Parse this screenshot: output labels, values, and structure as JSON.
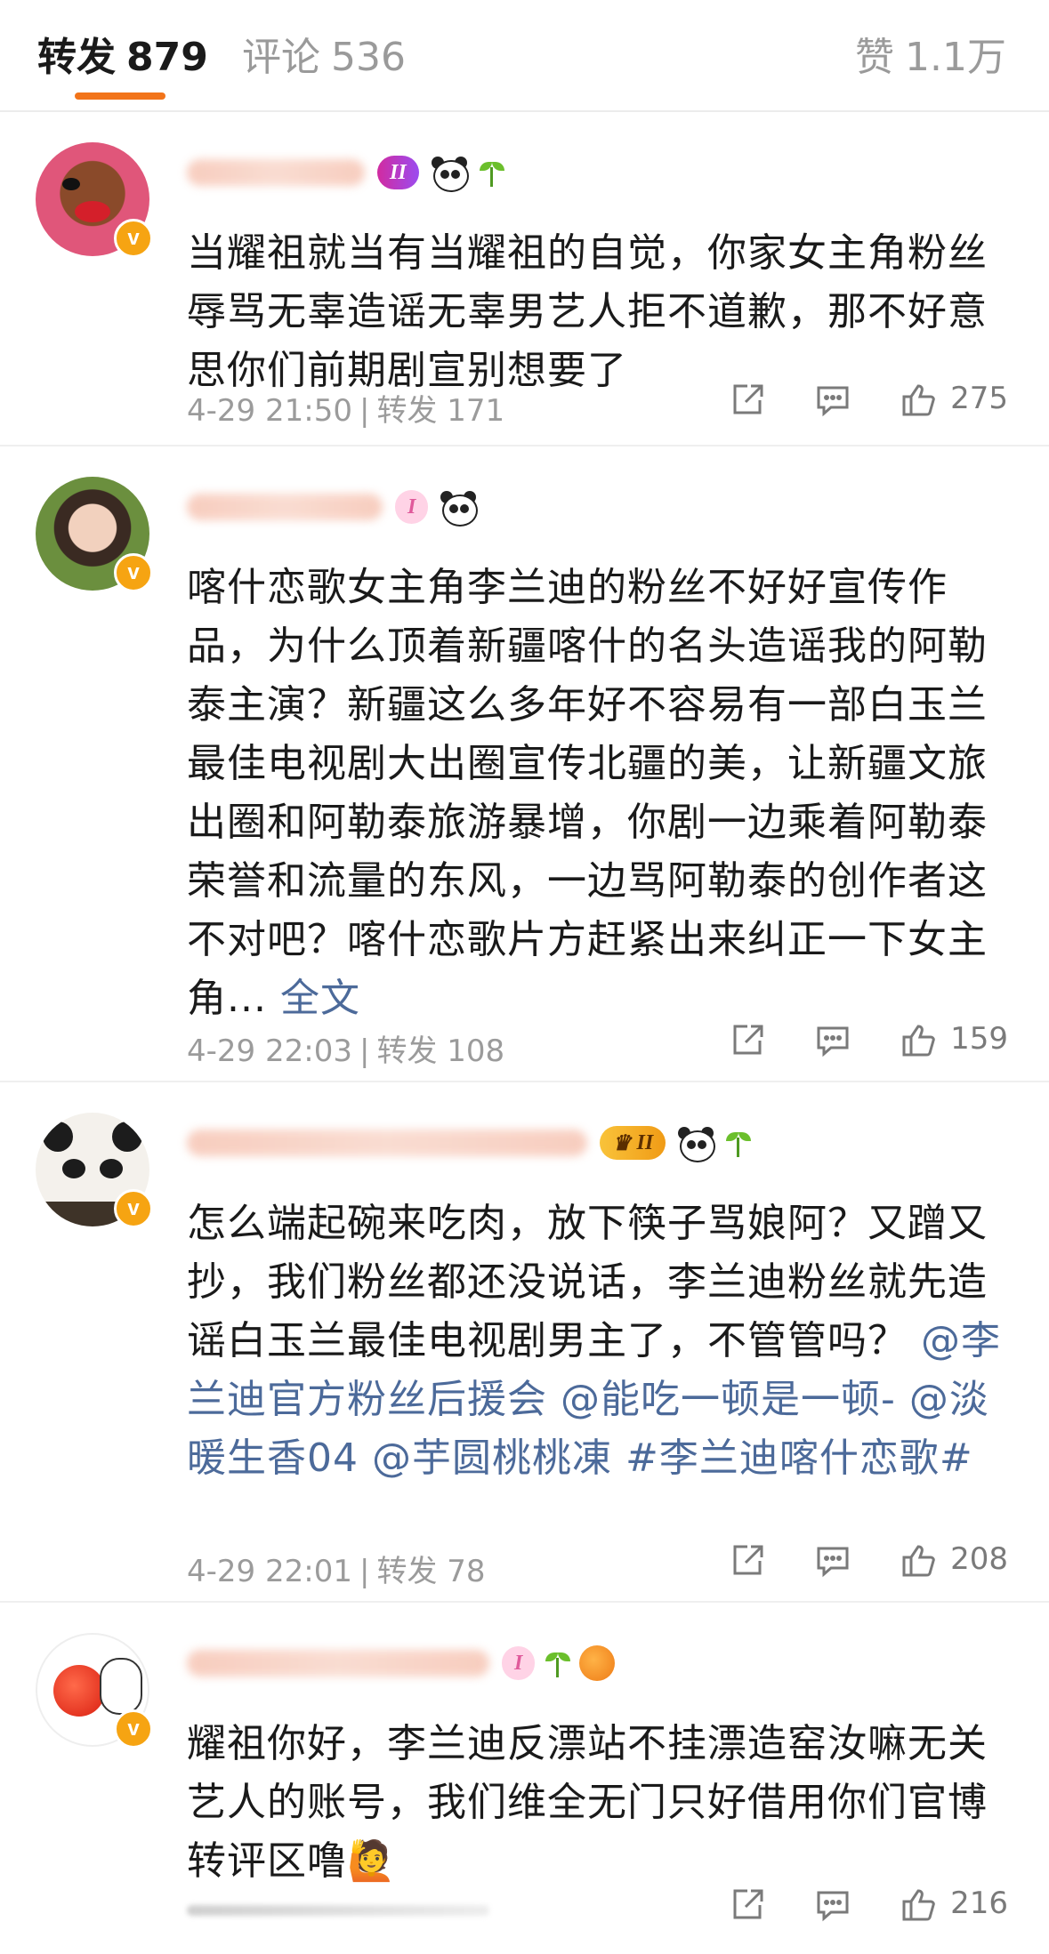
{
  "tabs": {
    "reposts": {
      "label": "转发",
      "count": "879"
    },
    "comments": {
      "label": "评论",
      "count": "536"
    },
    "likes": {
      "label": "赞",
      "count": "1.1万"
    }
  },
  "level_badge": "II",
  "level_badge_small": "I",
  "verified_mark": "v",
  "posts": [
    {
      "content": "当耀祖就当有当耀祖的自觉，你家女主角粉丝辱骂无辜造谣无辜男艺人拒不道歉，那不好意思你们前期剧宣别想要了",
      "time": "4-29 21:50",
      "repost_label": "转发 171",
      "likes": "275"
    },
    {
      "content": "喀什恋歌女主角李兰迪的粉丝不好好宣传作品，为什么顶着新疆喀什的名头造谣我的阿勒泰主演？新疆这么多年好不容易有一部白玉兰最佳电视剧大出圈宣传北疆的美，让新疆文旅出圈和阿勒泰旅游暴增，你剧一边乘着阿勒泰荣誉和流量的东风，一边骂阿勒泰的创作者这不对吧？喀什恋歌片方赶紧出来纠正一下女主角...",
      "more": "全文",
      "time": "4-29 22:03",
      "repost_label": "转发 108",
      "likes": "159"
    },
    {
      "content": "怎么端起碗来吃肉，放下筷子骂娘阿？又蹭又抄，我们粉丝都还没说话，李兰迪粉丝就先造谣白玉兰最佳电视剧男主了，不管管吗？",
      "mentions": "@李兰迪官方粉丝后援会 @能吃一顿是一顿- @淡暖生香04 @芋圆桃桃凍 #李兰迪喀什恋歌#",
      "time": "4-29 22:01",
      "repost_label": "转发 78",
      "likes": "208"
    },
    {
      "content": "耀祖你好，李兰迪反漂站不挂漂造窑汝嘛无关艺人的账号，我们维全无门只好借用你们官博转评区噜",
      "emoji": "🙋",
      "likes": "216"
    }
  ]
}
